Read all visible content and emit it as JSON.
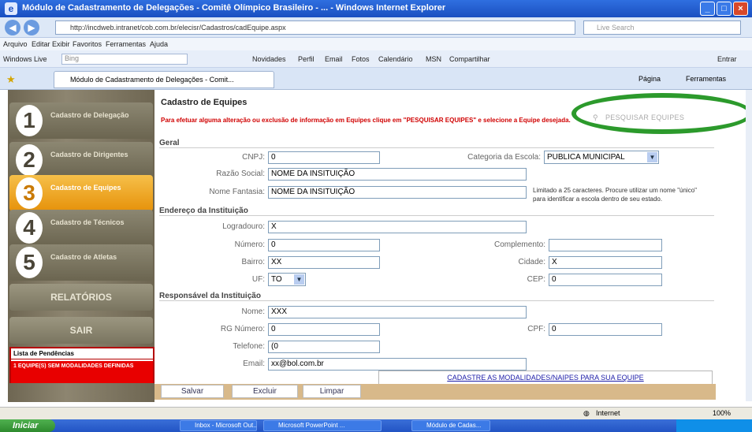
{
  "window": {
    "title": "Módulo de Cadastramento de Delegações - Comitê Olímpico Brasileiro - ... - Windows Internet Explorer",
    "address": "http://incdweb.intranet/cob.com.br/elecisr/Cadastros/cadEquipe.aspx",
    "search_placeholder": "Live Search"
  },
  "menubar": [
    "Arquivo",
    "Editar",
    "Exibir",
    "Favoritos",
    "Ferramentas",
    "Ajuda"
  ],
  "livebar": {
    "label": "Windows Live",
    "search": "Bing",
    "links": [
      "Novidades",
      "Perfil",
      "Email",
      "Fotos",
      "Calendário",
      "MSN",
      "Compartilhar"
    ],
    "entrar": "Entrar"
  },
  "tab": {
    "title": "Módulo de Cadastramento de Delegações - Comit...",
    "tools": [
      "Página",
      "Ferramentas"
    ]
  },
  "sidebar": {
    "items": [
      {
        "num": "1",
        "label": "Cadastro de Delegação"
      },
      {
        "num": "2",
        "label": "Cadastro de Dirigentes"
      },
      {
        "num": "3",
        "label": "Cadastro de Equipes"
      },
      {
        "num": "4",
        "label": "Cadastro de Técnicos"
      },
      {
        "num": "5",
        "label": "Cadastro de Atletas"
      }
    ],
    "relatorios": "RELATÓRIOS",
    "sair": "SAIR",
    "pendencias_title": "Lista de Pendências",
    "pendencias_item": "1 EQUIPE(S) SEM MODALIDADES DEFINIDAS"
  },
  "main": {
    "title": "Cadastro de Equipes",
    "warning": "Para efetuar alguma alteração ou exclusão de informação em Equipes clique em \"PESQUISAR EQUIPES\" e selecione a Equipe desejada.",
    "pesquisar": "PESQUISAR EQUIPES",
    "geral": {
      "section": "Geral",
      "cnpj_label": "CNPJ:",
      "cnpj": "0",
      "categoria_label": "Categoria da Escola:",
      "categoria": "PUBLICA MUNICIPAL",
      "razao_label": "Razão Social:",
      "razao": "NOME DA INSITUIÇÃO",
      "fantasia_label": "Nome Fantasia:",
      "fantasia": "NOME DA INSITUIÇÃO",
      "fantasia_note": "Limitado a 25 caracteres. Procure utilizar um nome \"único\" para identificar a escola dentro de seu estado."
    },
    "endereco": {
      "section": "Endereço da Instituição",
      "logradouro_label": "Logradouro:",
      "logradouro": "X",
      "numero_label": "Número:",
      "numero": "0",
      "complemento_label": "Complemento:",
      "complemento": "",
      "bairro_label": "Bairro:",
      "bairro": "XX",
      "cidade_label": "Cidade:",
      "cidade": "X",
      "uf_label": "UF:",
      "uf": "TO",
      "cep_label": "CEP:",
      "cep": "0"
    },
    "responsavel": {
      "section": "Responsável da Instituição",
      "nome_label": "Nome:",
      "nome": "XXX",
      "rg_label": "RG Número:",
      "rg": "0",
      "cpf_label": "CPF:",
      "cpf": "0",
      "telefone_label": "Telefone:",
      "telefone": "(0",
      "email_label": "Email:",
      "email": "xx@bol.com.br"
    },
    "cadastrar_modalidades": "CADASTRE AS MODALIDADES/NAIPES PARA SUA EQUIPE",
    "buttons": {
      "salvar": "Salvar",
      "excluir": "Excluir",
      "limpar": "Limpar"
    }
  },
  "statusbar": {
    "zone": "Internet",
    "zoom": "100%"
  },
  "taskbar": {
    "start": "Iniciar",
    "tasks": [
      "Inbox - Microsoft Out...",
      "Microsoft PowerPoint ...",
      "Módulo de Cadas..."
    ]
  },
  "colors": {
    "accent": "#e6920a",
    "highlight": "#2c9a2c",
    "warning": "#d00000"
  }
}
